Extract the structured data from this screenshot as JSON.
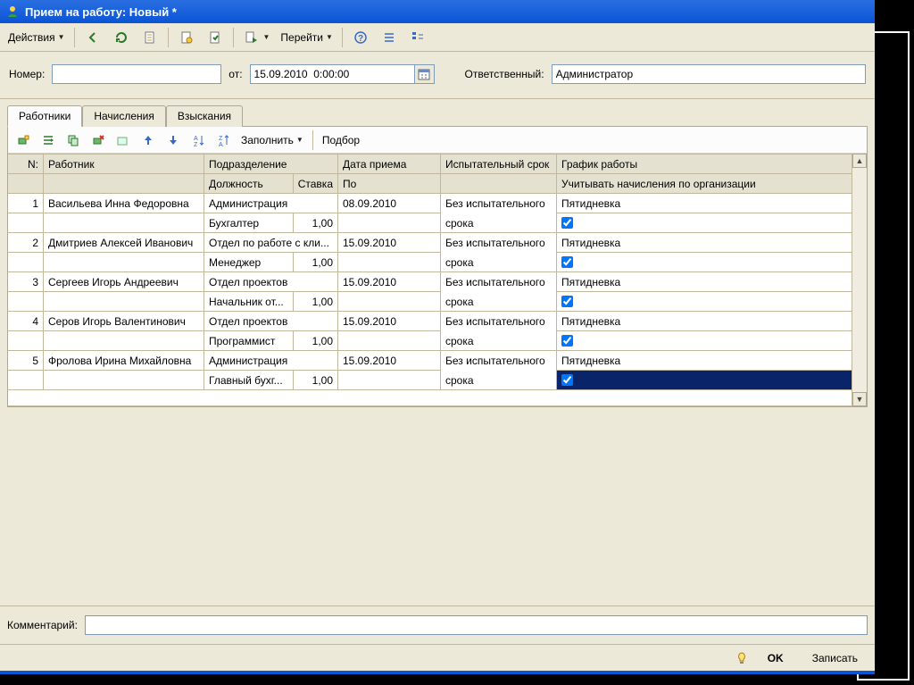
{
  "window": {
    "title": "Прием на работу: Новый *"
  },
  "toolbar": {
    "actions": "Действия",
    "go": "Перейти"
  },
  "fields": {
    "number_label": "Номер:",
    "number_value": "",
    "from_label": "от:",
    "from_value": "15.09.2010  0:00:00",
    "responsible_label": "Ответственный:",
    "responsible_value": "Администратор"
  },
  "tabs": [
    "Работники",
    "Начисления",
    "Взыскания"
  ],
  "panel_toolbar": {
    "fill": "Заполнить",
    "select": "Подбор"
  },
  "grid": {
    "headers1": {
      "n": "N:",
      "employee": "Работник",
      "dept": "Подразделение",
      "date": "Дата приема",
      "trial": "Испытательный срок",
      "schedule": "График работы"
    },
    "headers2": {
      "position": "Должность",
      "rate": "Ставка",
      "to": "По",
      "accrual": "Учитывать начисления по организации"
    },
    "rows": [
      {
        "n": "1",
        "employee": "Васильева Инна Федоровна",
        "dept": "Администрация",
        "date": "08.09.2010",
        "trial": "Без испытательного срока",
        "schedule": "Пятидневка",
        "position": "Бухгалтер",
        "rate": "1,00",
        "accrual": true
      },
      {
        "n": "2",
        "employee": "Дмитриев Алексей Иванович",
        "dept": "Отдел по работе с кли...",
        "date": "15.09.2010",
        "trial": "Без испытательного срока",
        "schedule": "Пятидневка",
        "position": "Менеджер",
        "rate": "1,00",
        "accrual": true
      },
      {
        "n": "3",
        "employee": "Сергеев Игорь Андреевич",
        "dept": "Отдел проектов",
        "date": "15.09.2010",
        "trial": "Без испытательного срока",
        "schedule": "Пятидневка",
        "position": "Начальник от...",
        "rate": "1,00",
        "accrual": true
      },
      {
        "n": "4",
        "employee": "Серов Игорь Валентинович",
        "dept": "Отдел проектов",
        "date": "15.09.2010",
        "trial": "Без испытательного срока",
        "schedule": "Пятидневка",
        "position": "Программист",
        "rate": "1,00",
        "accrual": true
      },
      {
        "n": "5",
        "employee": "Фролова Ирина Михайловна",
        "dept": "Администрация",
        "date": "15.09.2010",
        "trial": "Без испытательного срока",
        "schedule": "Пятидневка",
        "position": "Главный бухг...",
        "rate": "1,00",
        "accrual": true
      }
    ],
    "selected_index": 4
  },
  "comment": {
    "label": "Комментарий:",
    "value": ""
  },
  "buttons": {
    "ok": "OK",
    "save": "Записать"
  }
}
